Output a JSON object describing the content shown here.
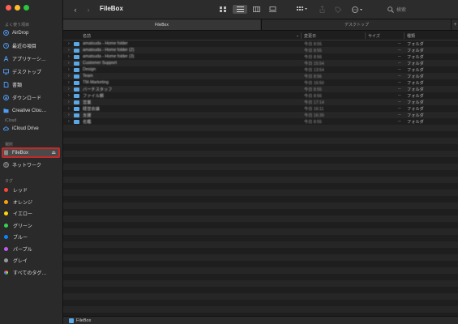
{
  "sidebar": {
    "favorites_title": "よく使う項目",
    "favorites": [
      {
        "label": "AirDrop",
        "icon": "airdrop-icon"
      },
      {
        "label": "最近の項目",
        "icon": "clock-icon"
      },
      {
        "label": "アプリケーシ…",
        "icon": "applications-icon"
      },
      {
        "label": "デスクトップ",
        "icon": "desktop-icon"
      },
      {
        "label": "書類",
        "icon": "document-icon"
      },
      {
        "label": "ダウンロード",
        "icon": "download-icon"
      },
      {
        "label": "Creative Clou…",
        "icon": "folder-icon"
      }
    ],
    "icloud_title": "iCloud",
    "icloud": [
      {
        "label": "iCloud Drive",
        "icon": "cloud-icon"
      }
    ],
    "locations_title": "場所",
    "locations": [
      {
        "label": "FileBox",
        "icon": "drive-icon",
        "eject": "⏏"
      },
      {
        "label": "ネットワーク",
        "icon": "network-icon"
      }
    ],
    "tags_title": "タグ",
    "tags": [
      {
        "label": "レッド",
        "color": "#ff453a"
      },
      {
        "label": "オレンジ",
        "color": "#ff9f0a"
      },
      {
        "label": "イエロー",
        "color": "#ffd60a"
      },
      {
        "label": "グリーン",
        "color": "#32d74b"
      },
      {
        "label": "ブルー",
        "color": "#0a84ff"
      },
      {
        "label": "パープル",
        "color": "#bf5af2"
      },
      {
        "label": "グレイ",
        "color": "#98989d"
      },
      {
        "label": "すべてのタグ…",
        "color": "all-tags-icon"
      }
    ]
  },
  "toolbar": {
    "title": "FileBox",
    "back": "‹",
    "forward": "›",
    "search_placeholder": "検索"
  },
  "tabs": {
    "active": "FileBox",
    "inactive": "デスクトップ",
    "add": "+"
  },
  "columns": {
    "name": "名前",
    "date": "変更日",
    "size": "サイズ",
    "kind": "種類"
  },
  "files": [
    {
      "name": "amatsuda - Home folder",
      "date": "今日 8:55",
      "size": "--",
      "kind": "フォルダ"
    },
    {
      "name": "amatsuda - Home folder (2)",
      "date": "今日 8:55",
      "size": "--",
      "kind": "フォルダ"
    },
    {
      "name": "amatsuda - Home folder (3)",
      "date": "今日 8:56",
      "size": "--",
      "kind": "フォルダ"
    },
    {
      "name": "Customer Support",
      "date": "今日 15:54",
      "size": "--",
      "kind": "フォルダ"
    },
    {
      "name": "Design",
      "date": "今日 13:54",
      "size": "--",
      "kind": "フォルダ"
    },
    {
      "name": "Team",
      "date": "今日 8:56",
      "size": "--",
      "kind": "フォルダ"
    },
    {
      "name": "TM-Marketing",
      "date": "今日 16:50",
      "size": "--",
      "kind": "フォルダ"
    },
    {
      "name": "バーチスタッフ",
      "date": "今日 8:55",
      "size": "--",
      "kind": "フォルダ"
    },
    {
      "name": "ファイル類",
      "date": "今日 8:56",
      "size": "--",
      "kind": "フォルダ"
    },
    {
      "name": "営業",
      "date": "今日 17:14",
      "size": "--",
      "kind": "フォルダ"
    },
    {
      "name": "経営会議",
      "date": "今日 16:11",
      "size": "--",
      "kind": "フォルダ"
    },
    {
      "name": "支援",
      "date": "今日 16:39",
      "size": "--",
      "kind": "フォルダ"
    },
    {
      "name": "名鑑",
      "date": "今日 8:55",
      "size": "--",
      "kind": "フォルダ"
    }
  ],
  "empty_rows": 29,
  "pathbar": {
    "label": "FileBox"
  }
}
